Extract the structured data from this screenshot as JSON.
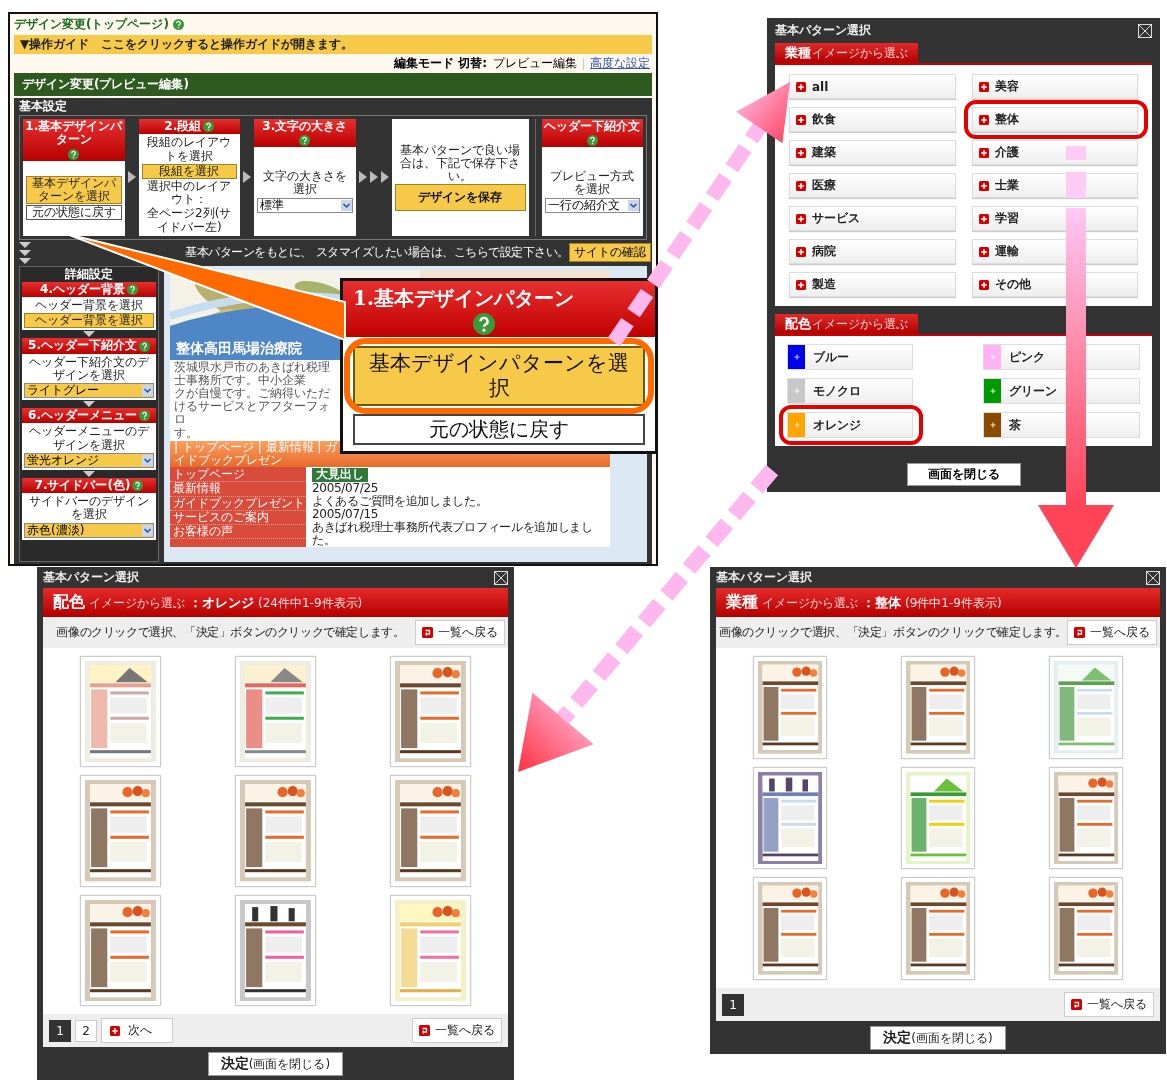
{
  "editor": {
    "title": "デザイン変更(トップページ)",
    "title_help": true,
    "guide": "▼操作ガイド　ここをクリックすると操作ガイドが開きます。",
    "mode_label": "編集モード 切替:",
    "mode_value": "プレビュー編集",
    "advanced_link": "高度な設定",
    "section_title": "デザイン変更(プレビュー編集)",
    "basic_label": "基本設定",
    "steps": [
      {
        "kind": "step",
        "title": "1.基本デザインパターン",
        "help": true,
        "controls": [
          {
            "kind": "button",
            "label": "基本デザインパターンを選択"
          },
          {
            "kind": "plain-button",
            "label": "元の状態に戻す"
          }
        ]
      },
      {
        "kind": "step",
        "title": "2.段組",
        "help": true,
        "controls": [
          {
            "kind": "text",
            "label": "段組のレイアウトを選択"
          },
          {
            "kind": "button",
            "label": "段組を選択"
          },
          {
            "kind": "text",
            "label": "選択中のレイアウト："
          },
          {
            "kind": "text",
            "label": "全ページ2列(サイドバー左)"
          }
        ]
      },
      {
        "kind": "step",
        "title": "3.文字の大きさ",
        "help": true,
        "controls": [
          {
            "kind": "text",
            "label": "文字の大きさを選択"
          },
          {
            "kind": "select",
            "label": "標準"
          }
        ]
      },
      {
        "kind": "save",
        "controls": [
          {
            "kind": "text",
            "label": "基本パターンで良い場合は、下記で保存下さい。"
          },
          {
            "kind": "big-button",
            "label": "デザインを保存"
          }
        ]
      },
      {
        "kind": "step",
        "title": "ヘッダー下紹介文",
        "help": true,
        "controls": [
          {
            "kind": "text",
            "label": "プレビュー方式を選択"
          },
          {
            "kind": "select",
            "label": "一行の紹介文"
          }
        ]
      }
    ],
    "hint_parts": [
      "基本パターンをもとに、",
      "スタマイズしたい場合は、こちらで設定下さい。"
    ],
    "site_check": "サイトの確認",
    "detail_label": "詳細設定",
    "details": [
      {
        "title": "4.ヘッダー背景",
        "help": true,
        "controls": [
          {
            "kind": "text",
            "label": "ヘッダー背景を選択"
          },
          {
            "kind": "button",
            "label": "ヘッダー背景を選択"
          }
        ]
      },
      {
        "title": "5.ヘッダー下紹介文",
        "help": true,
        "controls": [
          {
            "kind": "text",
            "label": "ヘッダー下紹介文のデザインを選択"
          },
          {
            "kind": "select",
            "label": "ライトグレー"
          }
        ]
      },
      {
        "title": "6.ヘッダーメニュー",
        "help": true,
        "controls": [
          {
            "kind": "text",
            "label": "ヘッダーメニューのデザインを選択"
          },
          {
            "kind": "select",
            "label": "蛍光オレンジ"
          }
        ]
      },
      {
        "title": "7.サイドバー(色)",
        "help": true,
        "controls": [
          {
            "kind": "text",
            "label": "サイドバーのデザインを選択"
          },
          {
            "kind": "select",
            "label": "赤色(濃淡)"
          }
        ]
      }
    ],
    "site": {
      "name": "整体高田馬場治療院",
      "intro_lines": [
        "茨城県水戸市のあきばれ税理士事務所です。中小企業",
        "クが自慢です。ご納得いただけるサービスとアフターフォロ",
        "す。"
      ],
      "nav": "| トップページ | 最新情報 | ガイドブックプレゼン",
      "menu": [
        "トップページ",
        "最新情報",
        "ガイドブックプレゼント",
        "サービスのご案内",
        "お客様の声"
      ],
      "heading": "大見出し",
      "news": [
        {
          "date": "2005/07/25",
          "text": "よくあるご質問を追加しました。"
        },
        {
          "date": "2005/07/15",
          "text": "あきばれ税理士事務所代表プロフィールを追加しました。"
        }
      ]
    }
  },
  "callout": {
    "title": "1.基本デザインパターン",
    "help": true,
    "button": "基本デザインパターンを選択",
    "highlighted": true,
    "reset": "元の状態に戻す"
  },
  "category_dialog": {
    "title": "基本パターン選択",
    "sections": [
      {
        "kind": "list",
        "heading": "業種",
        "subheading": "イメージから選ぶ",
        "items": [
          {
            "label": "all",
            "highlighted": false
          },
          {
            "label": "美容",
            "highlighted": false
          },
          {
            "label": "飲食",
            "highlighted": false
          },
          {
            "label": "整体",
            "highlighted": true
          },
          {
            "label": "建築",
            "highlighted": false
          },
          {
            "label": "介護",
            "highlighted": false
          },
          {
            "label": "医療",
            "highlighted": false
          },
          {
            "label": "士業",
            "highlighted": false
          },
          {
            "label": "サービス",
            "highlighted": false
          },
          {
            "label": "学習",
            "highlighted": false
          },
          {
            "label": "病院",
            "highlighted": false
          },
          {
            "label": "運輸",
            "highlighted": false
          },
          {
            "label": "製造",
            "highlighted": false
          },
          {
            "label": "その他",
            "highlighted": false
          }
        ]
      },
      {
        "kind": "colors",
        "heading": "配色",
        "subheading": "イメージから選ぶ",
        "items": [
          {
            "label": "ブルー",
            "color": "#0000f0",
            "highlighted": false
          },
          {
            "label": "ピンク",
            "color": "#ffb3f5",
            "highlighted": false
          },
          {
            "label": "モノクロ",
            "color": "#c8c8c8",
            "highlighted": false
          },
          {
            "label": "グリーン",
            "color": "#009900",
            "highlighted": false
          },
          {
            "label": "オレンジ",
            "color": "#ffa500",
            "highlighted": true
          },
          {
            "label": "茶",
            "color": "#8b4a00",
            "highlighted": false
          }
        ]
      }
    ],
    "close": "画面を閉じる"
  },
  "result_dialogs": [
    {
      "title": "基本パターン選択",
      "heading": "配色",
      "subheading": "イメージから選ぶ",
      "filter": "：オレンジ",
      "count": "(24件中1-9件表示)",
      "instruction": "画像のクリックで選択、「決定」ボタンのクリックで確定します。",
      "back": "一覧へ戻る",
      "thumbnails": [
        {
          "kind": "picture"
        },
        {
          "kind": "picture"
        },
        {
          "kind": "picture"
        },
        {
          "kind": "picture"
        },
        {
          "kind": "picture"
        },
        {
          "kind": "picture"
        },
        {
          "kind": "picture"
        },
        {
          "kind": "picture"
        },
        {
          "kind": "picture"
        }
      ],
      "pages": [
        {
          "label": "1",
          "selected": true
        },
        {
          "label": "2",
          "selected": false
        }
      ],
      "next": "次へ",
      "back_bottom": "一覧へ戻る",
      "confirm": "**決定**(画面を閉じる)"
    },
    {
      "title": "基本パターン選択",
      "heading": "業種",
      "subheading": "イメージから選ぶ",
      "filter": "：整体",
      "count": "(9件中1-9件表示)",
      "instruction": "画像のクリックで選択、「決定」ボタンのクリックで確定します。",
      "back": "一覧へ戻る",
      "thumbnails": [
        {
          "kind": "picture"
        },
        {
          "kind": "picture"
        },
        {
          "kind": "picture"
        },
        {
          "kind": "picture"
        },
        {
          "kind": "picture"
        },
        {
          "kind": "picture"
        },
        {
          "kind": "picture"
        },
        {
          "kind": "picture"
        },
        {
          "kind": "picture"
        }
      ],
      "pages": [
        {
          "label": "1",
          "selected": true
        }
      ],
      "back_bottom": "一覧へ戻る",
      "confirm": "**決定**(画面を閉じる)"
    }
  ]
}
